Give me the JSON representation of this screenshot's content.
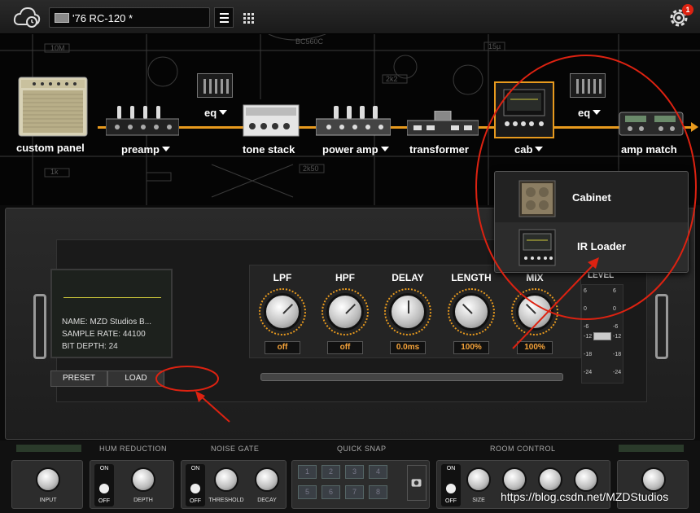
{
  "topbar": {
    "preset_name": "'76 RC-120 *",
    "notification_count": "1"
  },
  "chain": {
    "modules": [
      {
        "id": "custom-panel",
        "label": "custom panel",
        "has_menu": false
      },
      {
        "id": "preamp",
        "label": "preamp",
        "has_menu": true
      },
      {
        "id": "eq1",
        "label": "eq",
        "has_menu": true
      },
      {
        "id": "tone-stack",
        "label": "tone stack",
        "has_menu": false
      },
      {
        "id": "power-amp",
        "label": "power amp",
        "has_menu": true
      },
      {
        "id": "transformer",
        "label": "transformer",
        "has_menu": false
      },
      {
        "id": "cab",
        "label": "cab",
        "has_menu": true
      },
      {
        "id": "eq2",
        "label": "eq",
        "has_menu": true
      },
      {
        "id": "amp-match",
        "label": "amp match",
        "has_menu": false
      }
    ],
    "accent_color": "#e89a1e"
  },
  "cab_dropdown": {
    "items": [
      {
        "label": "Cabinet",
        "icon": "cabinet-icon"
      },
      {
        "label": "IR Loader",
        "icon": "ir-loader-icon"
      }
    ]
  },
  "ir_loader": {
    "info": {
      "name": "NAME: MZD Studios B...",
      "sample_rate": "SAMPLE RATE: 44100",
      "bit_depth": "BIT DEPTH: 24"
    },
    "buttons": {
      "preset": "PRESET",
      "load": "LOAD"
    },
    "knobs": [
      {
        "label": "LPF",
        "value": "off",
        "angle": 225
      },
      {
        "label": "HPF",
        "value": "off",
        "angle": 225
      },
      {
        "label": "DELAY",
        "value": "0.0ms",
        "angle": 180
      },
      {
        "label": "LENGTH",
        "value": "100%",
        "angle": 135
      },
      {
        "label": "MIX",
        "value": "100%",
        "angle": 135
      }
    ],
    "level": {
      "label": "LEVEL",
      "scale_left": [
        "6",
        "0",
        "-6",
        "-12",
        "-18",
        "-24"
      ],
      "scale_right": [
        "6",
        "0",
        "-6",
        "-12",
        "-18",
        "-24"
      ]
    }
  },
  "bottom": {
    "sections": [
      "HUM REDUCTION",
      "NOISE GATE",
      "QUICK SNAP",
      "ROOM CONTROL"
    ],
    "knob_labels": {
      "input": "INPUT",
      "depth": "DEPTH",
      "threshold": "THRESHOLD",
      "decay": "DECAY",
      "size": "SIZE"
    },
    "toggle_on": "ON",
    "toggle_off": "OFF",
    "snaps": [
      "1",
      "2",
      "3",
      "4",
      "5",
      "6",
      "7",
      "8"
    ]
  },
  "watermark": "https://blog.csdn.net/MZDStudios"
}
